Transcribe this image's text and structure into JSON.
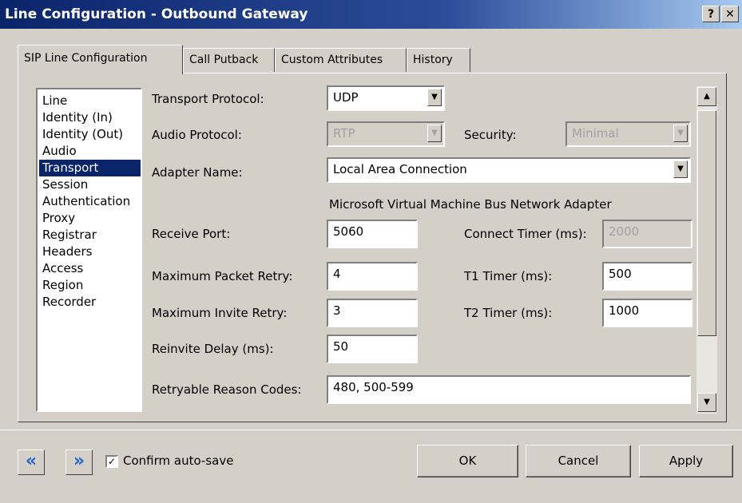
{
  "window": {
    "title": "Line Configuration - Outbound Gateway",
    "help_label": "?",
    "close_label": "✕"
  },
  "tabs": [
    {
      "label": "SIP Line Configuration",
      "active": true
    },
    {
      "label": "Call Putback",
      "active": false
    },
    {
      "label": "Custom Attributes",
      "active": false
    },
    {
      "label": "History",
      "active": false
    }
  ],
  "sections": {
    "items": [
      "Line",
      "Identity (In)",
      "Identity (Out)",
      "Audio",
      "Transport",
      "Session",
      "Authentication",
      "Proxy",
      "Registrar",
      "Headers",
      "Access",
      "Region",
      "Recorder"
    ],
    "selected": "Transport"
  },
  "form": {
    "transport_protocol": {
      "label": "Transport Protocol:",
      "value": "UDP"
    },
    "audio_protocol": {
      "label": "Audio Protocol:",
      "value": "RTP",
      "disabled": true
    },
    "security": {
      "label": "Security:",
      "value": "Minimal",
      "disabled": true
    },
    "adapter_name": {
      "label": "Adapter Name:",
      "value": "Local Area Connection"
    },
    "adapter_description": "Microsoft Virtual Machine Bus Network Adapter",
    "receive_port": {
      "label": "Receive Port:",
      "value": "5060"
    },
    "connect_timer": {
      "label": "Connect Timer (ms):",
      "value": "2000",
      "disabled": true
    },
    "max_packet_retry": {
      "label": "Maximum Packet Retry:",
      "value": "4"
    },
    "t1_timer": {
      "label": "T1 Timer (ms):",
      "value": "500"
    },
    "max_invite_retry": {
      "label": "Maximum Invite Retry:",
      "value": "3"
    },
    "t2_timer": {
      "label": "T2 Timer (ms):",
      "value": "1000"
    },
    "reinvite_delay": {
      "label": "Reinvite Delay (ms):",
      "value": "50"
    },
    "retryable_codes": {
      "label": "Retryable Reason Codes:",
      "value": "480, 500-599"
    }
  },
  "footer": {
    "prev_label": "«",
    "next_label": "»",
    "confirm_autosave": {
      "label": "Confirm auto-save",
      "checked": true,
      "mark": "✓"
    },
    "ok_label": "OK",
    "cancel_label": "Cancel",
    "apply_label": "Apply"
  },
  "icons": {
    "dropdown_arrow": "▼",
    "scroll_up": "▲",
    "scroll_down": "▼"
  },
  "colors": {
    "title_bar": "#0a246a",
    "selection": "#0a246a",
    "nav_arrow": "#1e64c8"
  }
}
